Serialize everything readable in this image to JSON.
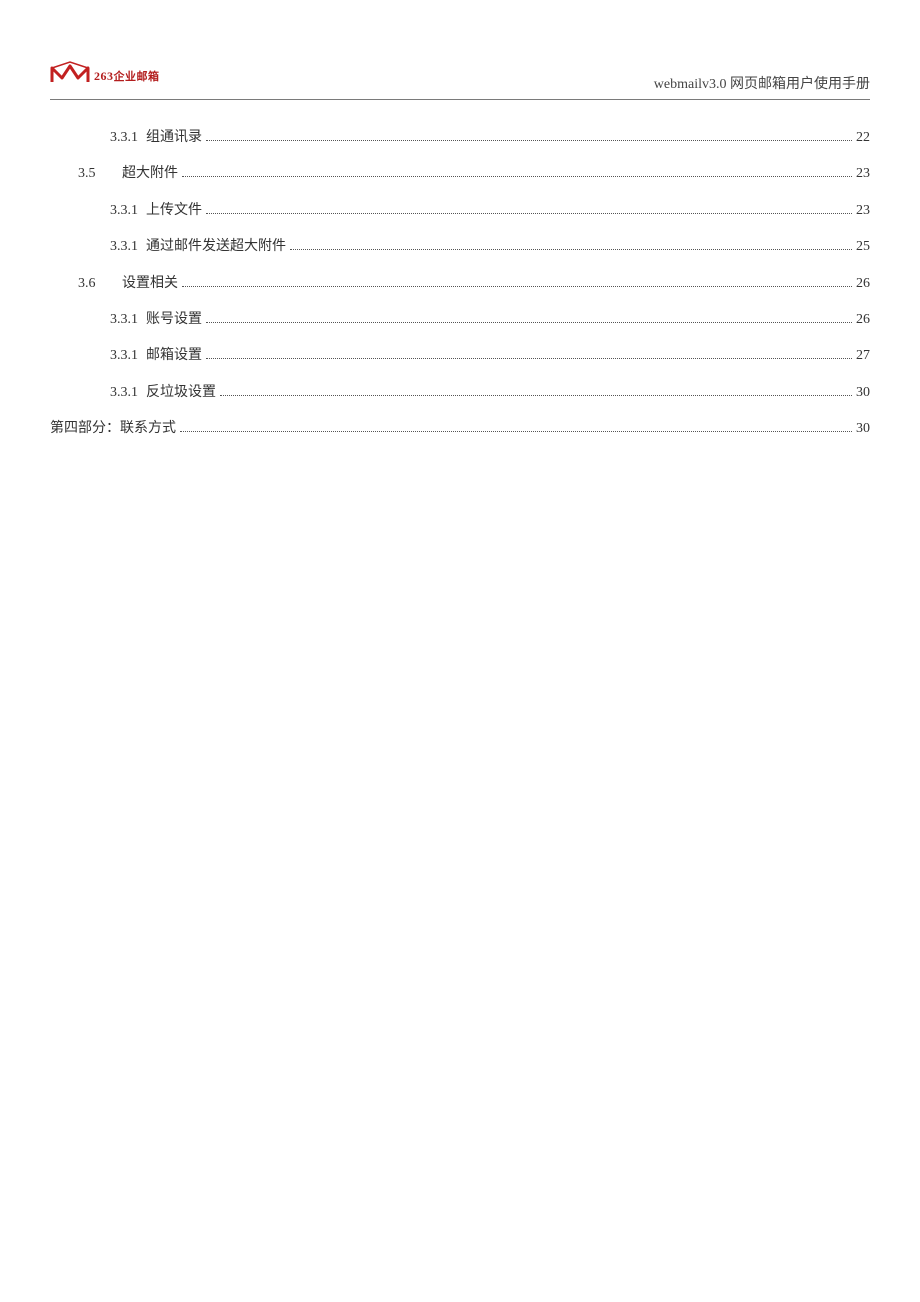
{
  "header": {
    "logo_brand": "263",
    "logo_suffix": "企业邮箱",
    "doc_title": "webmailv3.0 网页邮箱用户使用手册"
  },
  "toc": [
    {
      "indent": 2,
      "num": "3.3.1",
      "title": "组通讯录",
      "page": "22"
    },
    {
      "indent": 1,
      "num": "3.5",
      "title": "超大附件",
      "page": "23"
    },
    {
      "indent": 2,
      "num": "3.3.1",
      "title": "上传文件",
      "page": "23"
    },
    {
      "indent": 2,
      "num": "3.3.1",
      "title": "通过邮件发送超大附件",
      "page": "25"
    },
    {
      "indent": 1,
      "num": "3.6",
      "title": "设置相关",
      "page": "26"
    },
    {
      "indent": 2,
      "num": "3.3.1",
      "title": "账号设置",
      "page": "26"
    },
    {
      "indent": 2,
      "num": "3.3.1",
      "title": "邮箱设置",
      "page": "27"
    },
    {
      "indent": 2,
      "num": "3.3.1",
      "title": "反垃圾设置",
      "page": "30"
    },
    {
      "indent": 0,
      "num": "",
      "title": "第四部分：联系方式",
      "page": "30"
    }
  ]
}
